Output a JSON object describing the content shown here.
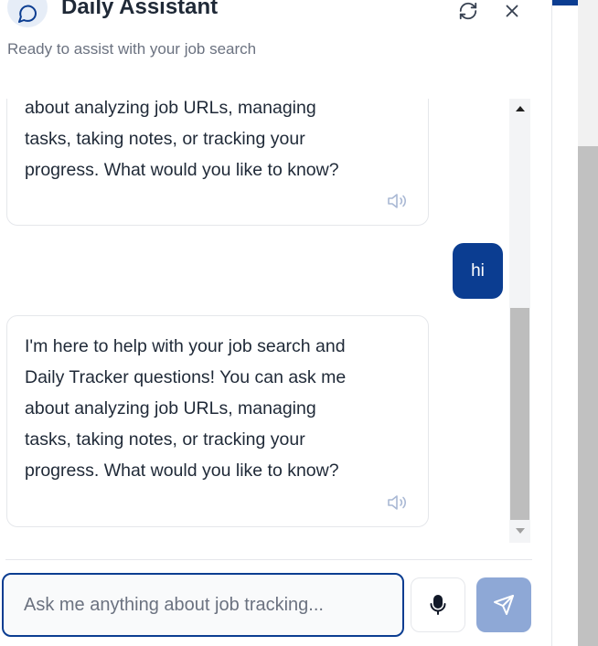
{
  "header": {
    "title": "Daily Assistant",
    "subtitle": "Ready to assist with your job search"
  },
  "icons": {
    "avatar": "chat-bubble-icon",
    "refresh": "refresh-icon",
    "close": "close-icon",
    "speaker": "speaker-icon",
    "mic": "mic-icon",
    "send": "send-icon"
  },
  "messages": [
    {
      "role": "assistant",
      "text": "about analyzing job URLs, managing\ntasks, taking notes, or tracking your\nprogress. What would you like to know?"
    },
    {
      "role": "user",
      "text": "hi"
    },
    {
      "role": "assistant",
      "text": "I'm here to help with your job search and\nDaily Tracker questions! You can ask me\nabout analyzing job URLs, managing\ntasks, taking notes, or tracking your\nprogress. What would you like to know?"
    }
  ],
  "input": {
    "placeholder": "Ask me anything about job tracking...",
    "value": ""
  },
  "colors": {
    "brand": "#0b3d91",
    "send_disabled": "#8ea8d6"
  }
}
